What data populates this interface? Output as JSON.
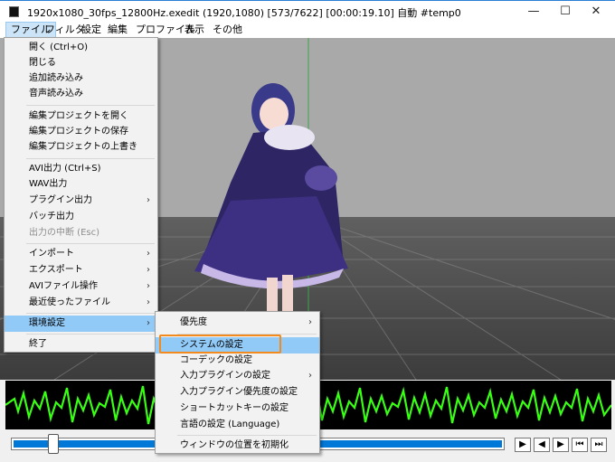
{
  "window": {
    "title": "1920x1080_30fps_12800Hz.exedit (1920,1080)  [573/7622]  [00:00:19.10]  自動  #temp0",
    "minimize_icon": "minimize-icon",
    "maximize_icon": "maximize-icon",
    "close_icon": "close-icon"
  },
  "menubar": {
    "items": [
      "ファイル",
      "フィルタ",
      "設定",
      "編集",
      "プロファイル",
      "表示",
      "その他"
    ]
  },
  "file_menu": {
    "items": [
      {
        "label": "開く (Ctrl+O)"
      },
      {
        "label": "閉じる"
      },
      {
        "label": "追加読み込み"
      },
      {
        "label": "音声読み込み"
      },
      {
        "label": "編集プロジェクトを開く"
      },
      {
        "label": "編集プロジェクトの保存"
      },
      {
        "label": "編集プロジェクトの上書き"
      },
      {
        "label": "AVI出力 (Ctrl+S)"
      },
      {
        "label": "WAV出力"
      },
      {
        "label": "プラグイン出力",
        "arrow": "›"
      },
      {
        "label": "バッチ出力"
      },
      {
        "label": "出力の中断 (Esc)"
      },
      {
        "label": "インポート",
        "arrow": "›"
      },
      {
        "label": "エクスポート",
        "arrow": "›"
      },
      {
        "label": "AVIファイル操作",
        "arrow": "›"
      },
      {
        "label": "最近使ったファイル",
        "arrow": "›"
      },
      {
        "label": "環境設定",
        "arrow": "›"
      },
      {
        "label": "終了"
      }
    ]
  },
  "env_submenu": {
    "items": [
      {
        "label": "優先度",
        "arrow": "›"
      },
      {
        "label": "システムの設定"
      },
      {
        "label": "コーデックの設定"
      },
      {
        "label": "入力プラグインの設定",
        "arrow": "›"
      },
      {
        "label": "入力プラグイン優先度の設定"
      },
      {
        "label": "ショートカットキーの設定"
      },
      {
        "label": "言語の設定 (Language)"
      },
      {
        "label": "ウィンドウの位置を初期化"
      }
    ]
  },
  "controls": {
    "seek_fraction": 0.075,
    "buttons": [
      {
        "name": "play-icon",
        "glyph": "▶"
      },
      {
        "name": "prev-frame-icon",
        "glyph": "◀"
      },
      {
        "name": "next-frame-icon",
        "glyph": "▶"
      },
      {
        "name": "go-start-icon",
        "glyph": "⏮"
      },
      {
        "name": "go-end-icon",
        "glyph": "⏭"
      }
    ]
  },
  "colors": {
    "menu_highlight": "#91c9f7",
    "focus_outline": "#f28a1e",
    "waveform": "#39ff14",
    "seek_fill": "#0078d7"
  }
}
